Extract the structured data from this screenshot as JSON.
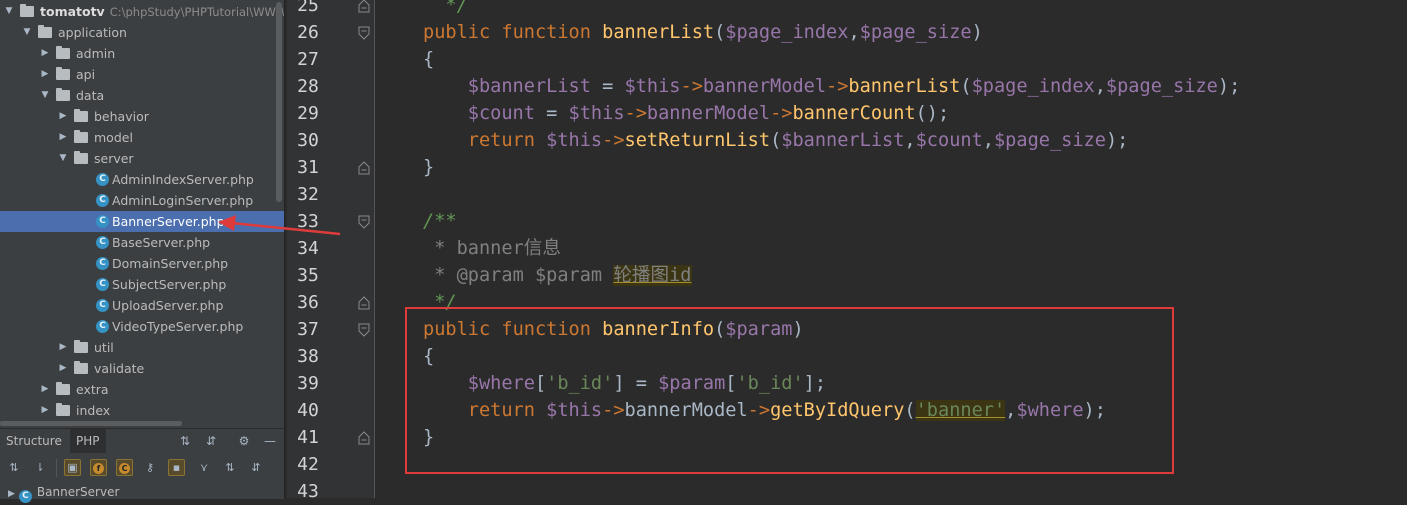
{
  "project_tree": {
    "root": {
      "name": "tomatotv",
      "path": "C:\\phpStudy\\PHPTutorial\\WWW\\"
    },
    "items": [
      {
        "label": "application",
        "kind": "folder",
        "level": 1,
        "expanded": true
      },
      {
        "label": "admin",
        "kind": "folder",
        "level": 2,
        "expanded": false
      },
      {
        "label": "api",
        "kind": "folder",
        "level": 2,
        "expanded": false
      },
      {
        "label": "data",
        "kind": "folder",
        "level": 2,
        "expanded": true
      },
      {
        "label": "behavior",
        "kind": "folder",
        "level": 3,
        "expanded": false
      },
      {
        "label": "model",
        "kind": "folder",
        "level": 3,
        "expanded": false
      },
      {
        "label": "server",
        "kind": "folder",
        "level": 3,
        "expanded": true
      },
      {
        "label": "AdminIndexServer.php",
        "kind": "class",
        "level": 4
      },
      {
        "label": "AdminLoginServer.php",
        "kind": "class",
        "level": 4
      },
      {
        "label": "BannerServer.php",
        "kind": "class",
        "level": 4,
        "selected": true
      },
      {
        "label": "BaseServer.php",
        "kind": "class",
        "level": 4
      },
      {
        "label": "DomainServer.php",
        "kind": "class",
        "level": 4
      },
      {
        "label": "SubjectServer.php",
        "kind": "class",
        "level": 4
      },
      {
        "label": "UploadServer.php",
        "kind": "class",
        "level": 4
      },
      {
        "label": "VideoTypeServer.php",
        "kind": "class",
        "level": 4
      },
      {
        "label": "util",
        "kind": "folder",
        "level": 3,
        "expanded": false
      },
      {
        "label": "validate",
        "kind": "folder",
        "level": 3,
        "expanded": false
      },
      {
        "label": "extra",
        "kind": "folder",
        "level": 2,
        "expanded": false
      },
      {
        "label": "index",
        "kind": "folder",
        "level": 2,
        "expanded": false
      }
    ]
  },
  "structure_panel": {
    "tabs": [
      "Structure",
      "PHP"
    ],
    "node": "BannerServer",
    "class_icon_letter": "C",
    "tool_letters": [
      "f",
      "C"
    ]
  },
  "editor": {
    "line_numbers": [
      "25",
      "26",
      "27",
      "28",
      "29",
      "30",
      "31",
      "32",
      "33",
      "34",
      "35",
      "36",
      "37",
      "38",
      "39",
      "40",
      "41",
      "42",
      "43"
    ],
    "colors": {
      "keyword": "#cc7832",
      "function": "#ffc66d",
      "variable": "#9876aa",
      "string": "#6a8759",
      "doc_comment": "#629755",
      "annotation_box": "#e03b3b"
    },
    "tokens": {
      "comment_end": "*/",
      "public": "public",
      "function": "function",
      "bannerList": "bannerList",
      "page_index": "$page_index",
      "page_size": "$page_size",
      "brace_open": "{",
      "brace_close": "}",
      "var_bannerList": "$bannerList",
      "this": "$this",
      "bannerModel": "bannerModel",
      "count": "$count",
      "bannerCount": "bannerCount",
      "return": "return",
      "setReturnList": "setReturnList",
      "doc_open": "/**",
      "doc_line1": "* banner信息",
      "doc_line2_prefix": "* @param $param ",
      "doc_line2_hl": "轮播图id",
      "doc_close": "*/",
      "bannerInfo": "bannerInfo",
      "param": "$param",
      "where": "$where",
      "b_id_str": "'b_id'",
      "getByIdQuery": "getByIdQuery",
      "banner_str": "'banner'"
    }
  }
}
